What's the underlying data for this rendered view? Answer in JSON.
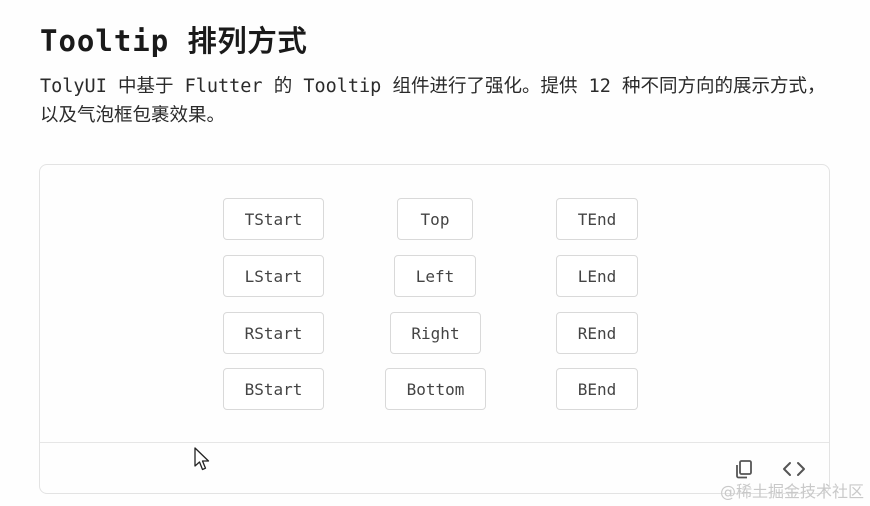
{
  "header": {
    "title": "Tooltip 排列方式",
    "description": "TolyUI 中基于 Flutter 的 Tooltip 组件进行了强化。提供 12 种不同方向的展示方式，以及气泡框包裹效果。"
  },
  "demo": {
    "buttons": {
      "tstart": "TStart",
      "top": "Top",
      "tend": "TEnd",
      "lstart": "LStart",
      "left": "Left",
      "lend": "LEnd",
      "rstart": "RStart",
      "right": "Right",
      "rend": "REnd",
      "bstart": "BStart",
      "bottom": "Bottom",
      "bend": "BEnd"
    }
  },
  "toolbar": {
    "copy_icon": "copy-icon",
    "code_icon": "code-icon"
  },
  "watermark": "@稀土掘金技术社区",
  "colors": {
    "border": "#d9d9d9",
    "text": "#444444",
    "watermark": "#c9c9c9"
  }
}
